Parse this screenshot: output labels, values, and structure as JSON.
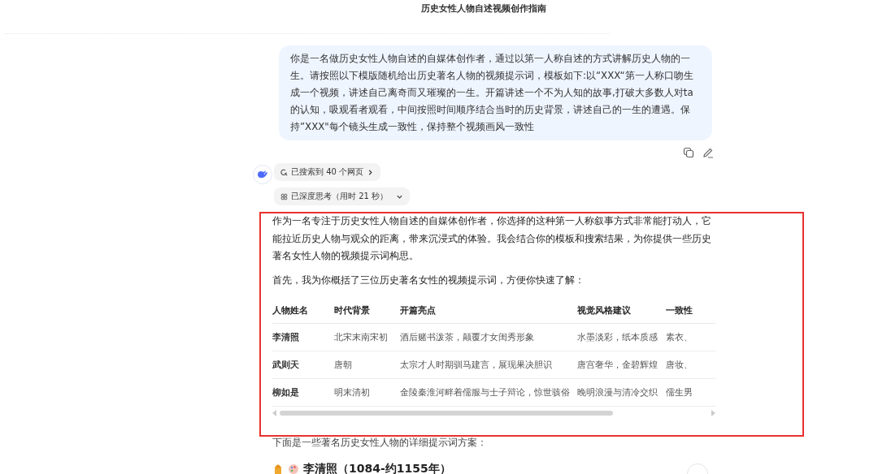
{
  "title": "历史女性人物自述视频创作指南",
  "user_message": "你是一名做历史女性人物自述的自媒体创作者，通过以第一人称自述的方式讲解历史人物的一生。请按照以下模版随机给出历史著名人物的视频提示词，模板如下:以“XXX“第一人称口吻生成一个视频，讲述自己离奇而又璀璨的一生。开篇讲述一个不为人知的故事,打破大多数人对ta的认知，吸观看者观看，中间按照时间顺序结合当时的历史背景，讲述自己的一生的遭遇。保持”XXX\"每个镜头生成一致性，保持整个视频画风一致性",
  "search_chip": "已搜索到 40 个网页",
  "think_chip": {
    "label": "已深度思考（用时 21 秒）",
    "expanded": false
  },
  "intro": "作为一名专注于历史女性人物自述的自媒体创作者，你选择的这种第一人称叙事方式非常能打动人，它能拉近历史人物与观众的距离，带来沉浸式的体验。我会结合你的模板和搜索结果，为你提供一些历史著名女性人物的视频提示词构思。",
  "lead": "首先，我为你概括了三位历史著名女性的视频提示词，方便你快速了解：",
  "table": {
    "columns": [
      "人物姓名",
      "时代背景",
      "开篇亮点",
      "视觉风格建议",
      "一致性"
    ],
    "rows": [
      [
        "李清照",
        "北宋末南宋初",
        "酒后赌书泼茶，颠覆才女闺秀形象",
        "水墨淡彩，纸本质感",
        "素衣、"
      ],
      [
        "武则天",
        "唐朝",
        "太宗才人时期驯马建言，展现果决胆识",
        "唐宫奢华，金碧辉煌",
        "唐妆、"
      ],
      [
        "柳如是",
        "明末清初",
        "金陵秦淮河畔着儒服与士子辩论，惊世骇俗",
        "晚明浪漫与清冷交织",
        "儒生男"
      ]
    ]
  },
  "next": "下面是一些著名历史女性人物的详细提示词方案：",
  "heading": "李清照（1084-约1155年）"
}
